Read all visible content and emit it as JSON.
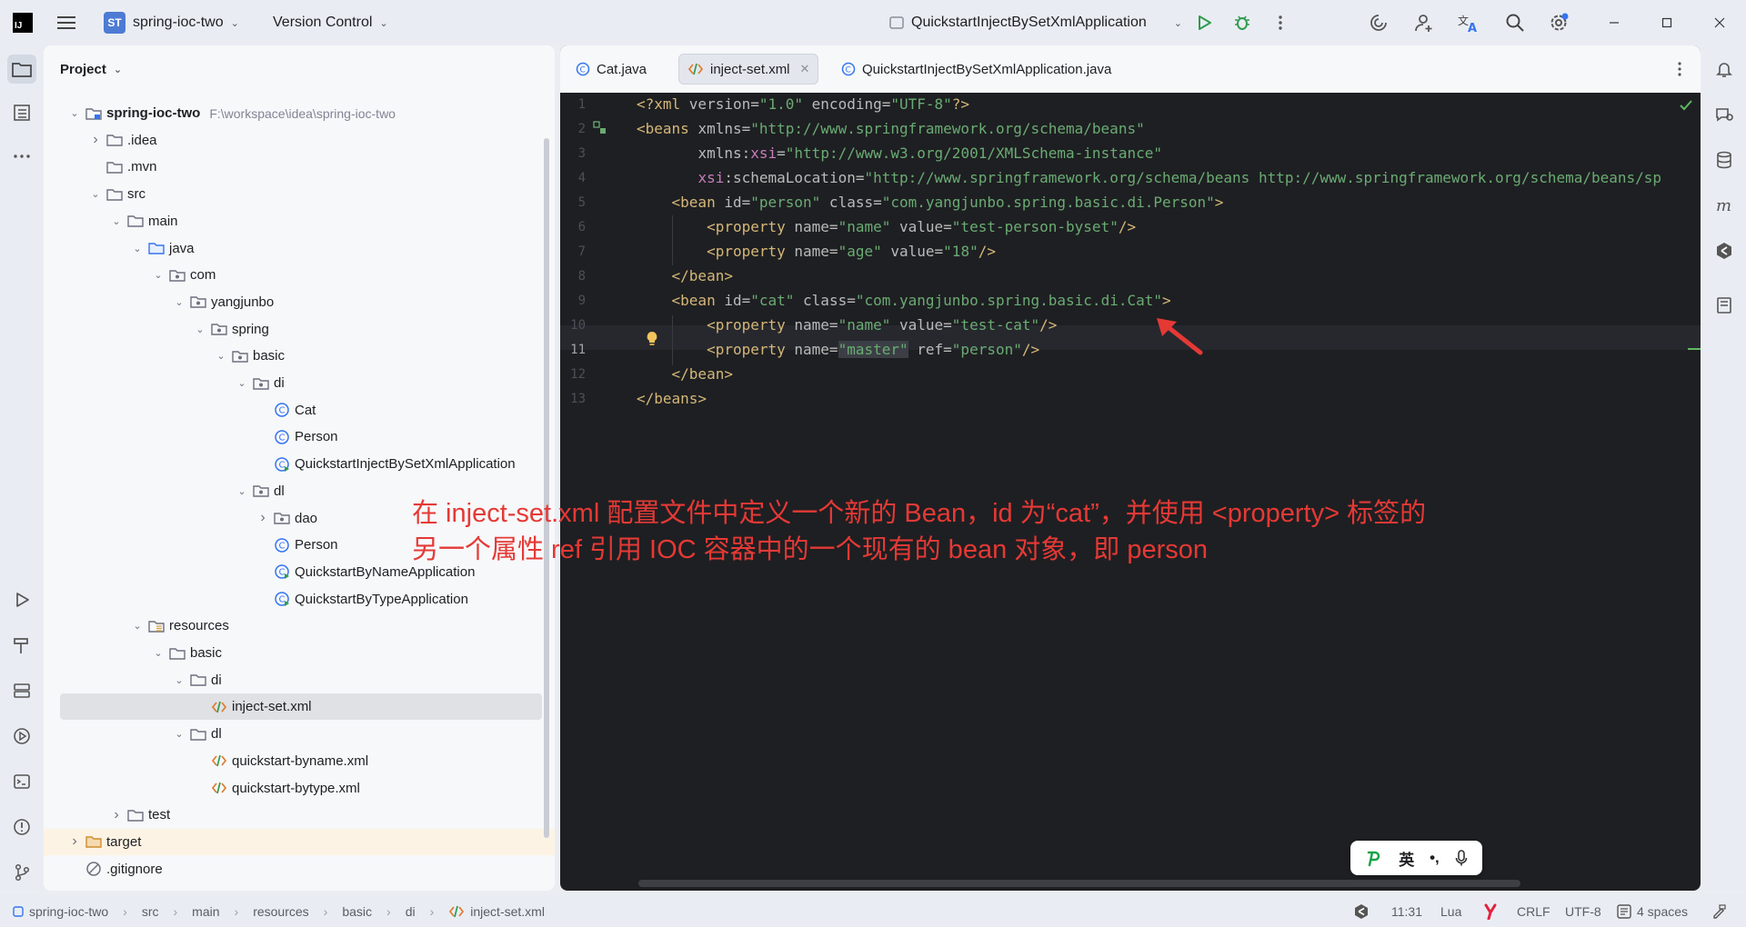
{
  "titlebar": {
    "project_badge": "ST",
    "project_name": "spring-ioc-two",
    "vcs_label": "Version Control",
    "run_config": "QuickstartInjectBySetXmlApplication",
    "icons": [
      "main-menu-icon",
      "run-icon",
      "debug-icon",
      "more-icon",
      "ai-assistant-icon",
      "add-user-icon",
      "translate-icon",
      "search-icon",
      "settings-icon",
      "minimize-icon",
      "maximize-icon",
      "close-icon"
    ]
  },
  "project_panel": {
    "title": "Project",
    "tree": [
      {
        "label": "spring-ioc-two",
        "path": "F:\\workspace\\idea\\spring-ioc-two",
        "icon": "module-folder",
        "arrow": "open",
        "bold": true
      },
      {
        "label": ".idea",
        "icon": "folder",
        "arrow": "closed"
      },
      {
        "label": ".mvn",
        "icon": "folder",
        "arrow": "none"
      },
      {
        "label": "src",
        "icon": "folder",
        "arrow": "open"
      },
      {
        "label": "main",
        "icon": "folder",
        "arrow": "open"
      },
      {
        "label": "java",
        "icon": "source-folder",
        "arrow": "open"
      },
      {
        "label": "com",
        "icon": "package",
        "arrow": "open"
      },
      {
        "label": "yangjunbo",
        "icon": "package",
        "arrow": "open"
      },
      {
        "label": "spring",
        "icon": "package",
        "arrow": "open"
      },
      {
        "label": "basic",
        "icon": "package",
        "arrow": "open"
      },
      {
        "label": "di",
        "icon": "package",
        "arrow": "open"
      },
      {
        "label": "Cat",
        "icon": "class",
        "arrow": "none"
      },
      {
        "label": "Person",
        "icon": "class",
        "arrow": "none"
      },
      {
        "label": "QuickstartInjectBySetXmlApplication",
        "icon": "class-run",
        "arrow": "none"
      },
      {
        "label": "dl",
        "icon": "package",
        "arrow": "open"
      },
      {
        "label": "dao",
        "icon": "package",
        "arrow": "closed"
      },
      {
        "label": "Person",
        "icon": "class",
        "arrow": "none"
      },
      {
        "label": "QuickstartByNameApplication",
        "icon": "class-run",
        "arrow": "none"
      },
      {
        "label": "QuickstartByTypeApplication",
        "icon": "class-run",
        "arrow": "none"
      },
      {
        "label": "resources",
        "icon": "resources-folder",
        "arrow": "open"
      },
      {
        "label": "basic",
        "icon": "folder",
        "arrow": "open"
      },
      {
        "label": "di",
        "icon": "folder",
        "arrow": "open"
      },
      {
        "label": "inject-set.xml",
        "icon": "xml-file",
        "arrow": "none"
      },
      {
        "label": "dl",
        "icon": "folder",
        "arrow": "open"
      },
      {
        "label": "quickstart-byname.xml",
        "icon": "xml-file",
        "arrow": "none"
      },
      {
        "label": "quickstart-bytype.xml",
        "icon": "xml-file",
        "arrow": "none"
      },
      {
        "label": "test",
        "icon": "folder",
        "arrow": "closed"
      },
      {
        "label": "target",
        "icon": "excluded-folder",
        "arrow": "closed"
      },
      {
        "label": ".gitignore",
        "icon": "ignore-file",
        "arrow": "none"
      }
    ]
  },
  "tabs": [
    {
      "label": "Cat.java",
      "icon": "class-icon",
      "active": false
    },
    {
      "label": "inject-set.xml",
      "icon": "xml-icon",
      "active": true
    },
    {
      "label": "QuickstartInjectBySetXmlApplication.java",
      "icon": "class-icon",
      "active": false
    }
  ],
  "editor": {
    "line_numbers": [
      "1",
      "2",
      "3",
      "4",
      "5",
      "6",
      "7",
      "8",
      "9",
      "10",
      "11",
      "12",
      "13"
    ],
    "current_line": "11",
    "annotation_line1": "在 inject-set.xml 配置文件中定义一个新的 Bean，id 为“cat”，并使用 <property> 标签的",
    "annotation_line2": "另一个属性 ref 引用 IOC 容器中的一个现有的 bean 对象，即 person",
    "annotation_color": "#e53935"
  },
  "ime": {
    "mode": "英",
    "punct": "•,"
  },
  "statusbar": {
    "breadcrumbs": [
      "spring-ioc-two",
      "src",
      "main",
      "resources",
      "basic",
      "di",
      "inject-set.xml"
    ],
    "position": "11:31",
    "language": "Lua",
    "line_ending": "CRLF",
    "encoding": "UTF-8",
    "indent": "4 spaces"
  },
  "colors": {
    "xml_tag": "#d5b778",
    "xml_value": "#6aab73",
    "xml_namespace": "#c77dbb",
    "editor_bg": "#1e1f22",
    "accent": "#3574f0"
  }
}
